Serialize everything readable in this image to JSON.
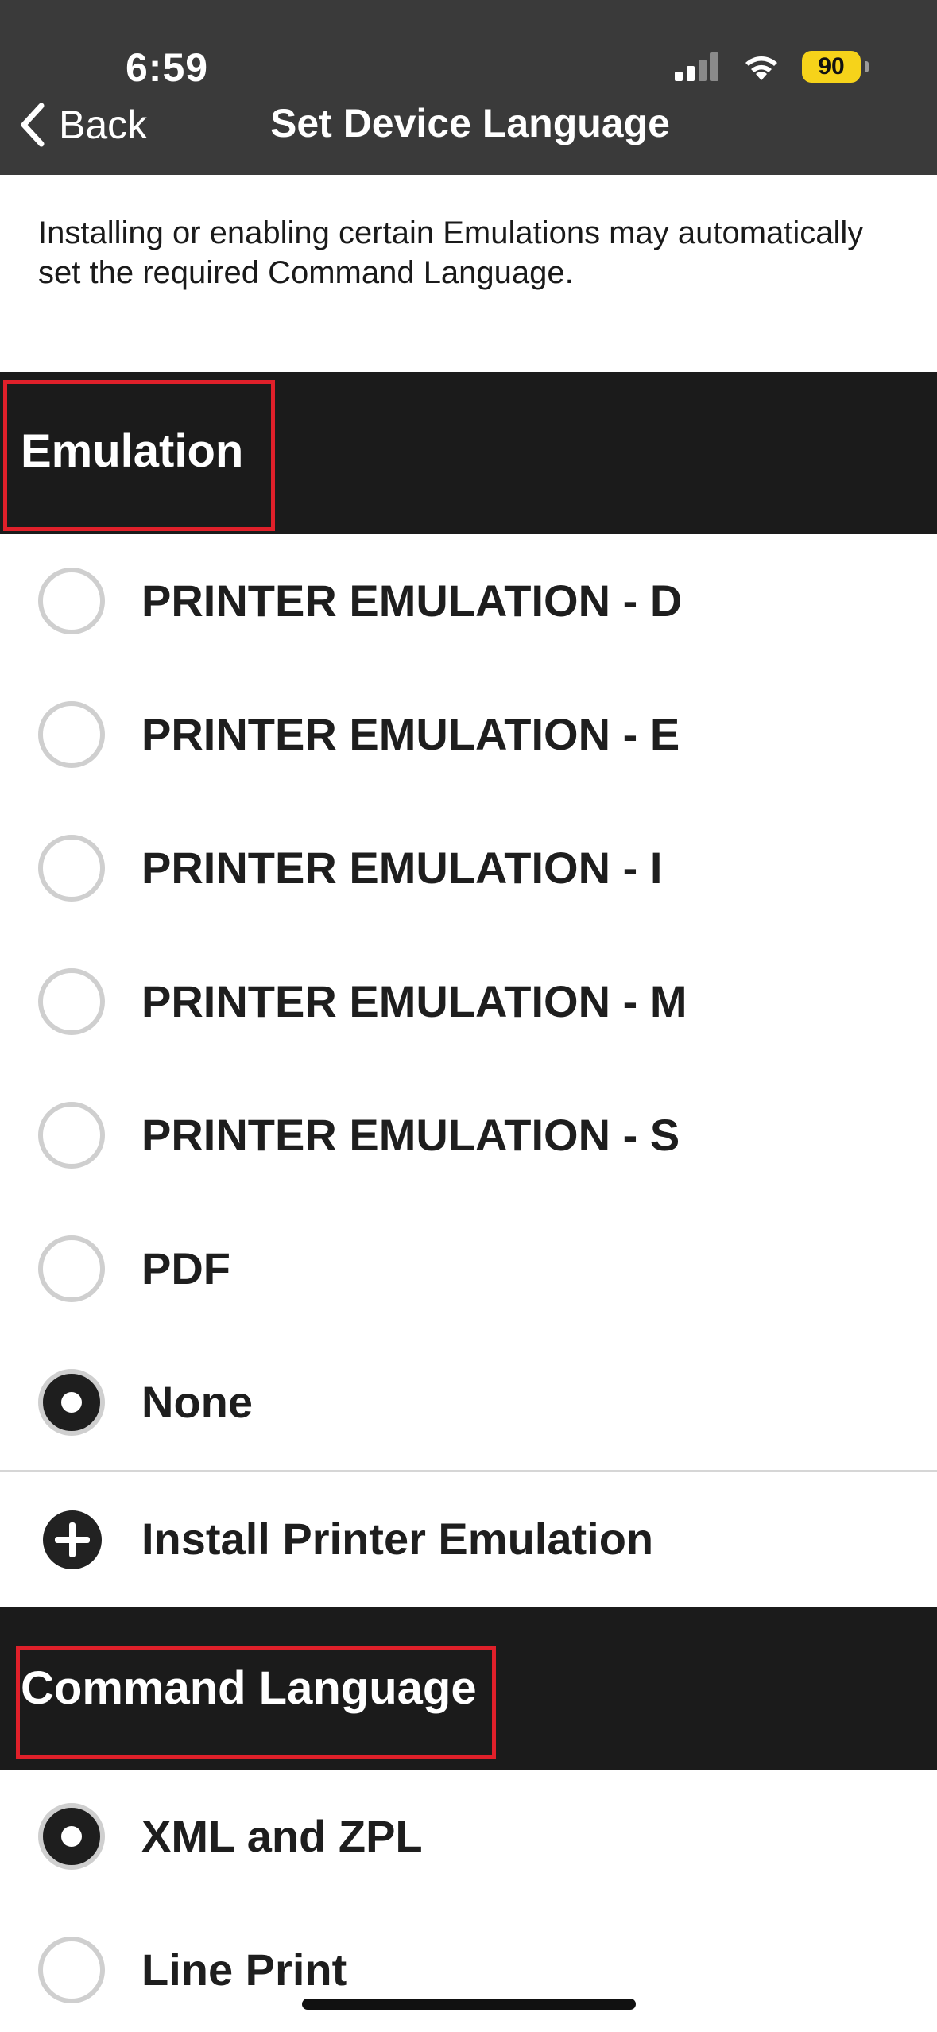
{
  "status_bar": {
    "time": "6:59",
    "battery_level": "90",
    "battery_color": "#f6d31a"
  },
  "nav": {
    "back_label": "Back",
    "title": "Set Device Language"
  },
  "description": "Installing or enabling certain Emulations may automatically set the required Command Language.",
  "emulation": {
    "title": "Emulation",
    "options": [
      {
        "label": "PRINTER EMULATION - D",
        "selected": false
      },
      {
        "label": "PRINTER EMULATION - E",
        "selected": false
      },
      {
        "label": "PRINTER EMULATION - I",
        "selected": false
      },
      {
        "label": "PRINTER EMULATION - M",
        "selected": false
      },
      {
        "label": "PRINTER EMULATION - S",
        "selected": false
      },
      {
        "label": "PDF",
        "selected": false
      },
      {
        "label": "None",
        "selected": true
      }
    ],
    "install_label": "Install Printer Emulation"
  },
  "command_language": {
    "title": "Command Language",
    "options": [
      {
        "label": "XML and ZPL",
        "selected": true
      },
      {
        "label": "Line Print",
        "selected": false
      }
    ]
  },
  "colors": {
    "header_bg": "#3a3a3a",
    "section_bg": "#1b1b1b",
    "highlight": "#e0202a"
  }
}
